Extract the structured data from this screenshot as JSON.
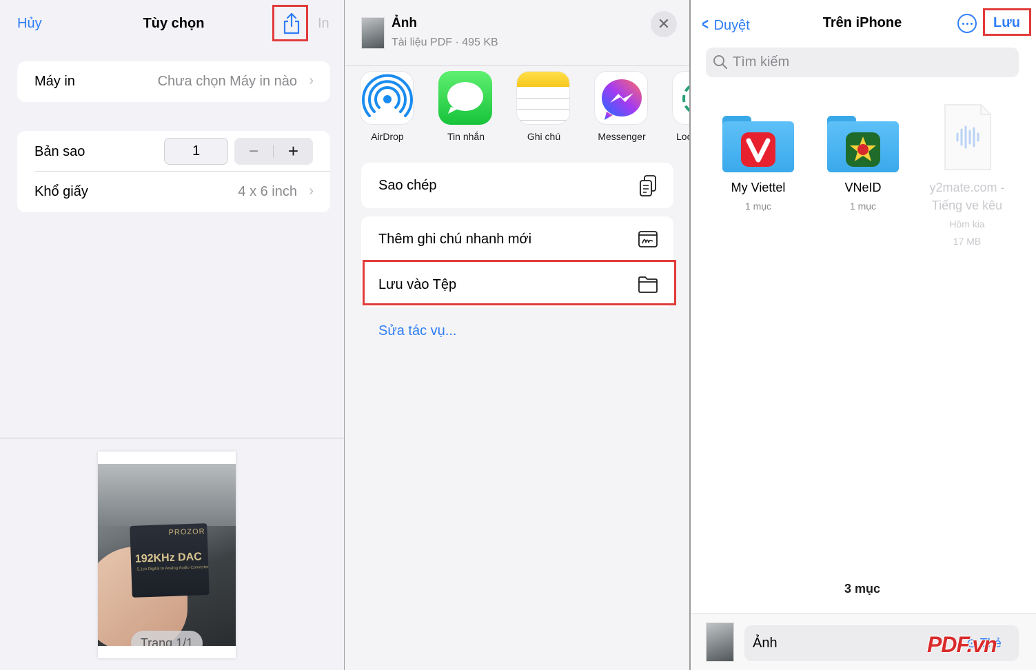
{
  "print_options": {
    "cancel": "Hủy",
    "title": "Tùy chọn",
    "print": "In",
    "printer_label": "Máy in",
    "printer_value": "Chưa chọn Máy in nào",
    "copies_label": "Bản sao",
    "copies_value": "1",
    "minus": "−",
    "plus": "+",
    "paper_label": "Khổ giấy",
    "paper_value": "4 x 6 inch",
    "page_indicator": "Trang 1/1",
    "photo_brand": "PROZOR",
    "photo_product": "192KHz DAC",
    "photo_subtitle": "5.1ch Digital to Analog Audio Converter"
  },
  "share_sheet": {
    "title": "Ảnh",
    "subtitle": "Tài liệu PDF · 495 KB",
    "apps": [
      {
        "label": "AirDrop"
      },
      {
        "label": "Tin nhắn"
      },
      {
        "label": "Ghi chú"
      },
      {
        "label": "Messenger"
      },
      {
        "label": "Loc"
      }
    ],
    "actions": [
      {
        "label": "Sao chép"
      },
      {
        "label": "Thêm ghi chú nhanh mới"
      },
      {
        "label": "Lưu vào Tệp"
      }
    ],
    "edit_actions": "Sửa tác vụ..."
  },
  "files": {
    "back": "Duyệt",
    "title": "Trên iPhone",
    "save": "Lưu",
    "search_placeholder": "Tìm kiếm",
    "items": [
      {
        "name": "My Viettel",
        "sub": "1 mục"
      },
      {
        "name": "VNeID",
        "sub": "1 mục"
      },
      {
        "name": "y2mate.com -",
        "name2": "Tiếng ve kêu",
        "sub": "Hôm kia",
        "sub2": "17 MB"
      }
    ],
    "count": "3 mục",
    "filename": "Ảnh",
    "tags": "Thẻ"
  },
  "watermark": "PDF.vn",
  "colors": {
    "accent": "#2f7df6",
    "highlight": "#e23b3b",
    "folder": "#4db5f2"
  }
}
